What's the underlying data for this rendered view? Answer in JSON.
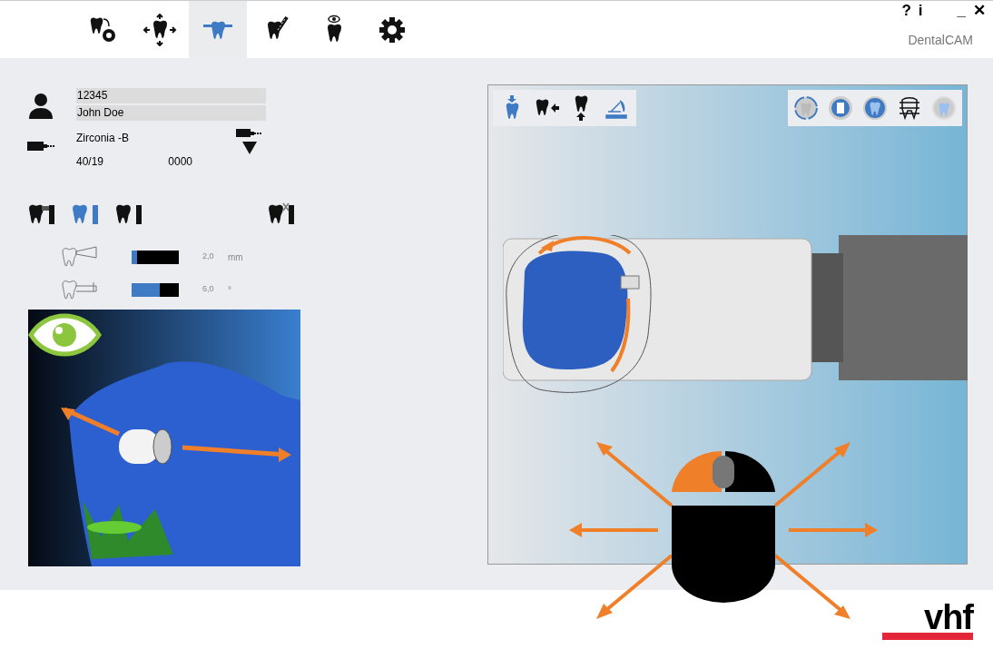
{
  "window": {
    "help": "?",
    "info": "i",
    "minimize": "_",
    "close": "✕",
    "app_name": "DentalCAM"
  },
  "nav_tabs": [
    {
      "kind": "tooth-disc",
      "selected": false
    },
    {
      "kind": "tooth-move",
      "selected": false
    },
    {
      "kind": "tooth-pin",
      "selected": true
    },
    {
      "kind": "tooth-tool",
      "selected": false
    },
    {
      "kind": "tooth-eye",
      "selected": false
    },
    {
      "kind": "settings",
      "selected": false
    }
  ],
  "patient": {
    "id": "12345",
    "name": "John Doe"
  },
  "material": {
    "name": "Zirconia -B",
    "size": "40/19",
    "code": "0000"
  },
  "tooth_modes": [
    {
      "selected": false
    },
    {
      "selected": true
    },
    {
      "selected": false
    },
    {
      "selected": false
    }
  ],
  "params": [
    {
      "kind": "distance",
      "level": 0.12,
      "value": "2,0",
      "unit": "mm"
    },
    {
      "kind": "angle",
      "level": 0.6,
      "value": "6,0",
      "unit": "°"
    }
  ],
  "view_tools": [
    {
      "kind": "tooth-down",
      "selected": true
    },
    {
      "kind": "tooth-left",
      "selected": false
    },
    {
      "kind": "tooth-up",
      "selected": false
    },
    {
      "kind": "holder",
      "selected": true
    }
  ],
  "logo": "vhf"
}
